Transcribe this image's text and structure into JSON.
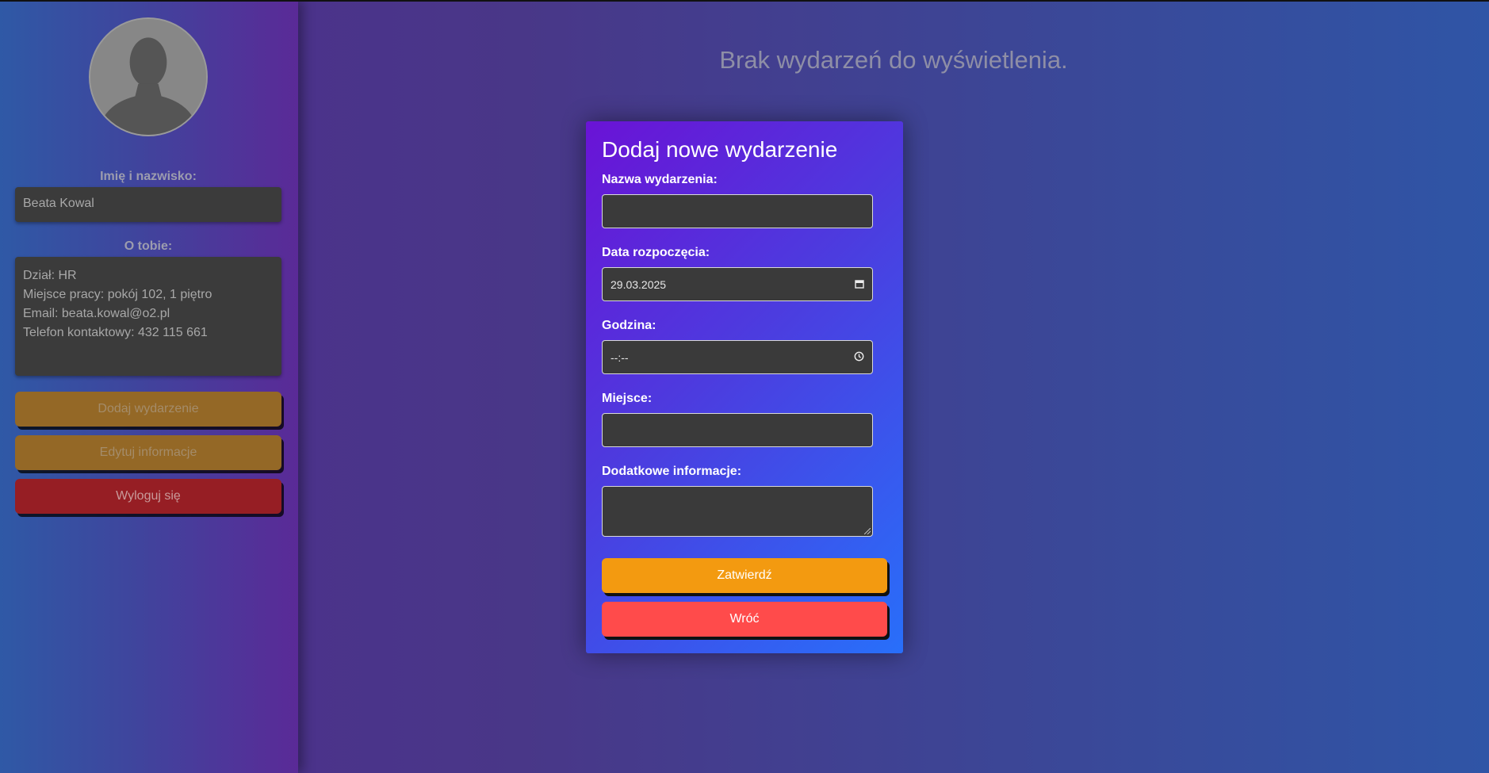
{
  "sidebar": {
    "name_label": "Imię i nazwisko:",
    "name_value": "Beata Kowal",
    "about_label": "O tobie:",
    "about_lines": [
      "Dział: HR",
      "Miejsce pracy: pokój 102, 1 piętro",
      "Email: beata.kowal@o2.pl",
      "Telefon kontaktowy: 432 115 661"
    ],
    "add_event_label": "Dodaj wydarzenie",
    "edit_info_label": "Edytuj informacje",
    "logout_label": "Wyloguj się"
  },
  "main": {
    "empty_message": "Brak wydarzeń do wyświetlenia."
  },
  "modal": {
    "title": "Dodaj nowe wydarzenie",
    "event_name_label": "Nazwa wydarzenia:",
    "event_name_value": "",
    "start_date_label": "Data rozpoczęcia:",
    "start_date_value": "29.03.2025",
    "time_label": "Godzina:",
    "time_value": "--:--",
    "place_label": "Miejsce:",
    "place_value": "",
    "extra_info_label": "Dodatkowe informacje:",
    "extra_info_value": "",
    "submit_label": "Zatwierdź",
    "back_label": "Wróć"
  },
  "icons": {
    "avatar": "user-silhouette-icon",
    "calendar": "calendar-icon",
    "clock": "clock-icon"
  },
  "colors": {
    "submit": "#f39a10",
    "back": "#ff4b4b",
    "logout": "#961e24",
    "sidebar_buttons": "#946826"
  }
}
